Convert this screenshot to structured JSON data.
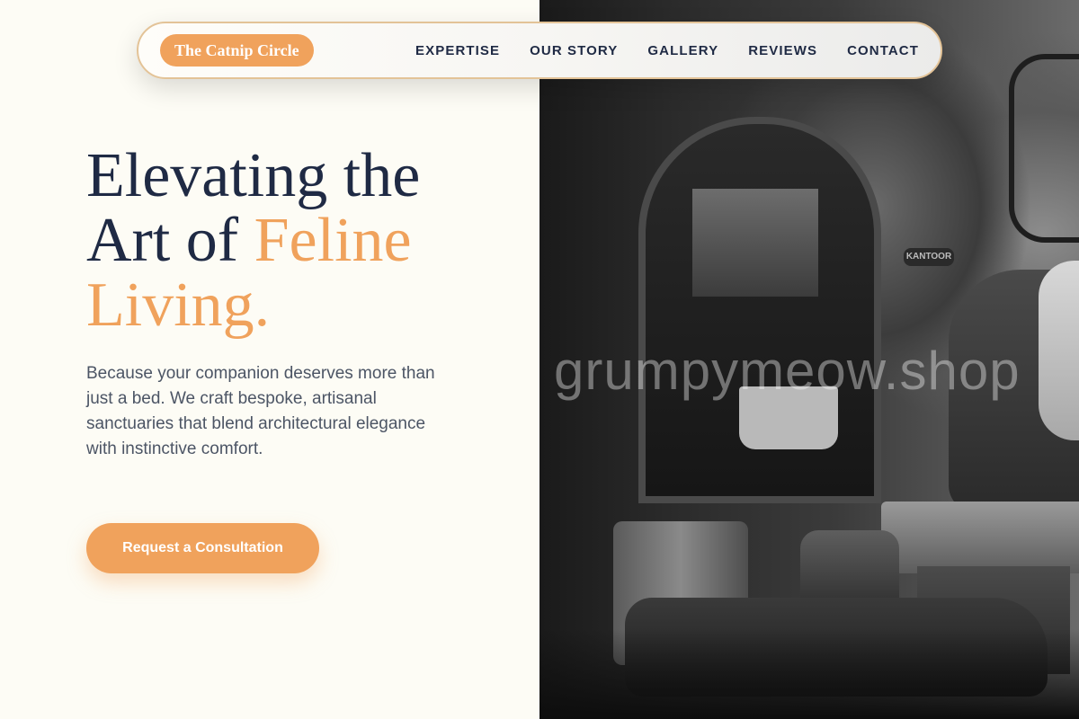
{
  "brand": {
    "name": "The Catnip Circle",
    "accent_color": "#f0a25c"
  },
  "nav": {
    "items": [
      {
        "label": "EXPERTISE"
      },
      {
        "label": "OUR STORY"
      },
      {
        "label": "GALLERY"
      },
      {
        "label": "REVIEWS"
      },
      {
        "label": "CONTACT"
      }
    ]
  },
  "hero": {
    "title_line1": "Elevating the",
    "title_line2_plain": "Art of",
    "title_line2_accent": "Feline",
    "title_line3_accent": "Living.",
    "description": "Because your companion deserves more than just a bed. We craft bespoke, artisanal sanctuaries that blend architectural elegance with instinctive comfort.",
    "cta_label": "Request a Consultation"
  },
  "photo": {
    "sign_text": "KANTOOR",
    "watermark": "grumpymeow.shop"
  },
  "colors": {
    "background": "#fdfcf5",
    "heading": "#1f2a44",
    "body_text": "#4c5565",
    "nav_border": "#e3c397"
  }
}
